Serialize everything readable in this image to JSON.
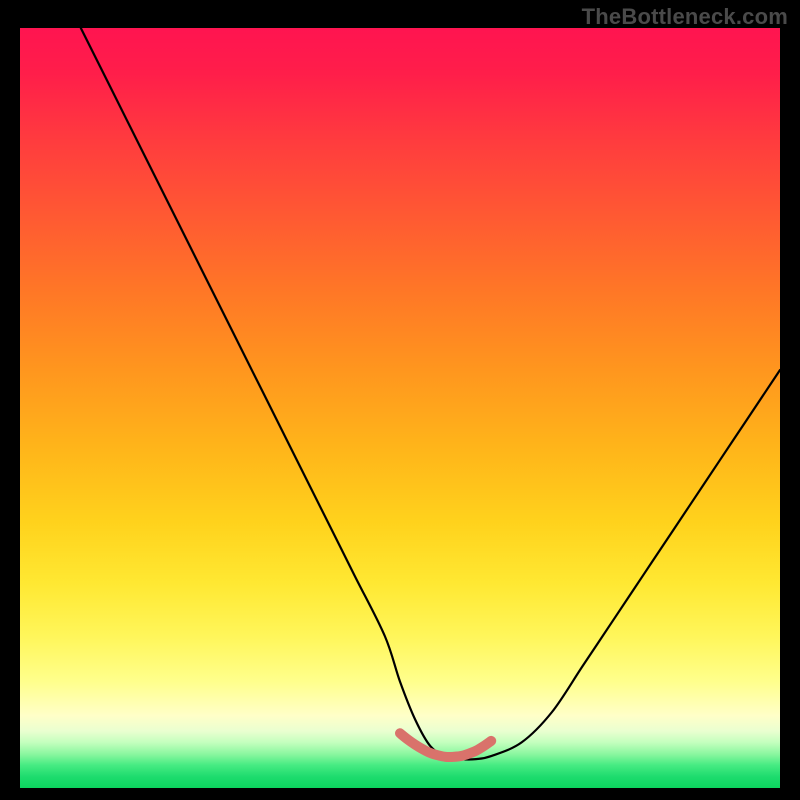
{
  "watermark": "TheBottleneck.com",
  "chart_data": {
    "type": "line",
    "title": "",
    "xlabel": "",
    "ylabel": "",
    "xlim": [
      0,
      100
    ],
    "ylim": [
      0,
      100
    ],
    "legend": false,
    "series": [
      {
        "name": "bottleneck-curve",
        "color": "#000000",
        "x": [
          8,
          12,
          16,
          20,
          24,
          28,
          32,
          36,
          40,
          44,
          48,
          50,
          52,
          54,
          56,
          58,
          60,
          62,
          66,
          70,
          74,
          78,
          82,
          86,
          90,
          94,
          98,
          100
        ],
        "values": [
          100,
          92,
          84,
          76,
          68,
          60,
          52,
          44,
          36,
          28,
          20,
          14,
          9,
          5.5,
          4.2,
          3.8,
          3.8,
          4.2,
          6,
          10,
          16,
          22,
          28,
          34,
          40,
          46,
          52,
          55
        ]
      },
      {
        "name": "optimal-zone-marker",
        "color": "#d9726b",
        "x": [
          50,
          51,
          52,
          53,
          54,
          55,
          56,
          57,
          58,
          59,
          60,
          61,
          62
        ],
        "values": [
          7.2,
          6.4,
          5.7,
          5.1,
          4.6,
          4.3,
          4.1,
          4.1,
          4.2,
          4.5,
          4.9,
          5.5,
          6.2
        ]
      }
    ],
    "background_gradient": {
      "stops": [
        {
          "pos": 0.0,
          "color": "#ff1450"
        },
        {
          "pos": 0.06,
          "color": "#ff1e4a"
        },
        {
          "pos": 0.15,
          "color": "#ff3c3e"
        },
        {
          "pos": 0.25,
          "color": "#ff5a32"
        },
        {
          "pos": 0.35,
          "color": "#ff7826"
        },
        {
          "pos": 0.45,
          "color": "#ff961e"
        },
        {
          "pos": 0.55,
          "color": "#ffb41a"
        },
        {
          "pos": 0.65,
          "color": "#ffd21c"
        },
        {
          "pos": 0.73,
          "color": "#ffe832"
        },
        {
          "pos": 0.8,
          "color": "#fff65a"
        },
        {
          "pos": 0.86,
          "color": "#ffff8c"
        },
        {
          "pos": 0.905,
          "color": "#ffffc8"
        },
        {
          "pos": 0.925,
          "color": "#eaffd0"
        },
        {
          "pos": 0.94,
          "color": "#c4ffbe"
        },
        {
          "pos": 0.955,
          "color": "#8cf7a0"
        },
        {
          "pos": 0.97,
          "color": "#46eb82"
        },
        {
          "pos": 0.985,
          "color": "#1edc6e"
        },
        {
          "pos": 1.0,
          "color": "#0cd45e"
        }
      ]
    }
  }
}
